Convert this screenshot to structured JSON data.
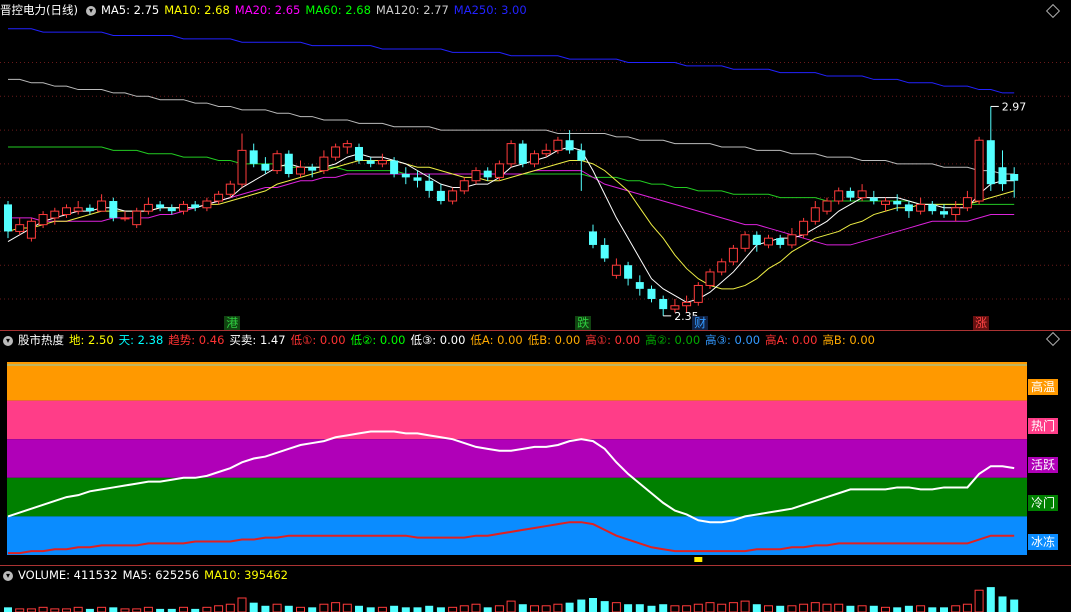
{
  "main_header": {
    "title": "晋控电力",
    "period": "(日线)",
    "ma": [
      {
        "label": "MA5:",
        "value": "2.75",
        "color": "#ffffff"
      },
      {
        "label": "MA10:",
        "value": "2.68",
        "color": "#ffff00"
      },
      {
        "label": "MA20:",
        "value": "2.65",
        "color": "#ff00ff"
      },
      {
        "label": "MA60:",
        "value": "2.68",
        "color": "#00ff00"
      },
      {
        "label": "MA120:",
        "value": "2.77",
        "color": "#cccccc"
      },
      {
        "label": "MA250:",
        "value": "3.00",
        "color": "#2222ff"
      }
    ]
  },
  "price_labels": {
    "high": "2.97",
    "low": "2.35"
  },
  "signals": [
    {
      "text": "港",
      "color": "#2ecc40",
      "bg": "#114411"
    },
    {
      "text": "跌",
      "color": "#2ecc40",
      "bg": "#114411"
    },
    {
      "text": "财",
      "color": "#3399ff",
      "bg": "#112244"
    },
    {
      "text": "涨",
      "color": "#ff4444",
      "bg": "#661111"
    }
  ],
  "heat_header": {
    "name": "股市热度",
    "items": [
      {
        "label": "地:",
        "value": "2.50",
        "color": "#ffff00"
      },
      {
        "label": "天:",
        "value": "2.38",
        "color": "#00ffff"
      },
      {
        "label": "趋势:",
        "value": "0.46",
        "color": "#ff3333"
      },
      {
        "label": "买卖:",
        "value": "1.47",
        "color": "#ffffff"
      },
      {
        "label": "低①:",
        "value": "0.00",
        "color": "#ff3333"
      },
      {
        "label": "低②:",
        "value": "0.00",
        "color": "#00ff00"
      },
      {
        "label": "低③:",
        "value": "0.00",
        "color": "#ffffff"
      },
      {
        "label": "低A:",
        "value": "0.00",
        "color": "#ffaa00"
      },
      {
        "label": "低B:",
        "value": "0.00",
        "color": "#ffaa00"
      },
      {
        "label": "高①:",
        "value": "0.00",
        "color": "#ff3333"
      },
      {
        "label": "高②:",
        "value": "0.00",
        "color": "#00aa00"
      },
      {
        "label": "高③:",
        "value": "0.00",
        "color": "#3399ff"
      },
      {
        "label": "高A:",
        "value": "0.00",
        "color": "#ff3333"
      },
      {
        "label": "高B:",
        "value": "0.00",
        "color": "#ffaa00"
      }
    ]
  },
  "zones": [
    {
      "label": "高温",
      "color": "#ff9900"
    },
    {
      "label": "热门",
      "color": "#ff3d88"
    },
    {
      "label": "活跃",
      "color": "#b000b8"
    },
    {
      "label": "冷门",
      "color": "#008000"
    },
    {
      "label": "冰冻",
      "color": "#0a8cff"
    }
  ],
  "vol_header": {
    "items": [
      {
        "label": "VOLUME:",
        "value": "411532",
        "color": "#ffffff"
      },
      {
        "label": "MA5:",
        "value": "625256",
        "color": "#ffffff"
      },
      {
        "label": "MA10:",
        "value": "395462",
        "color": "#ffff00"
      }
    ]
  },
  "chart_data": {
    "type": "candlestick",
    "candles": [
      [
        2.68,
        2.6,
        2.69,
        2.58
      ],
      [
        2.6,
        2.62,
        2.64,
        2.59
      ],
      [
        2.58,
        2.63,
        2.64,
        2.57
      ],
      [
        2.62,
        2.65,
        2.66,
        2.61
      ],
      [
        2.64,
        2.66,
        2.67,
        2.62
      ],
      [
        2.65,
        2.67,
        2.68,
        2.64
      ],
      [
        2.66,
        2.67,
        2.69,
        2.65
      ],
      [
        2.67,
        2.66,
        2.68,
        2.65
      ],
      [
        2.66,
        2.69,
        2.71,
        2.66
      ],
      [
        2.69,
        2.64,
        2.7,
        2.63
      ],
      [
        2.64,
        2.64,
        2.66,
        2.63
      ],
      [
        2.62,
        2.66,
        2.67,
        2.61
      ],
      [
        2.66,
        2.68,
        2.7,
        2.65
      ],
      [
        2.68,
        2.67,
        2.69,
        2.66
      ],
      [
        2.67,
        2.66,
        2.68,
        2.65
      ],
      [
        2.66,
        2.68,
        2.69,
        2.65
      ],
      [
        2.68,
        2.67,
        2.69,
        2.66
      ],
      [
        2.67,
        2.69,
        2.7,
        2.66
      ],
      [
        2.69,
        2.71,
        2.72,
        2.68
      ],
      [
        2.71,
        2.74,
        2.75,
        2.7
      ],
      [
        2.74,
        2.84,
        2.89,
        2.73
      ],
      [
        2.84,
        2.8,
        2.86,
        2.79
      ],
      [
        2.8,
        2.78,
        2.82,
        2.77
      ],
      [
        2.78,
        2.83,
        2.84,
        2.77
      ],
      [
        2.83,
        2.77,
        2.84,
        2.76
      ],
      [
        2.77,
        2.79,
        2.81,
        2.76
      ],
      [
        2.79,
        2.78,
        2.8,
        2.76
      ],
      [
        2.78,
        2.82,
        2.84,
        2.77
      ],
      [
        2.82,
        2.85,
        2.86,
        2.81
      ],
      [
        2.85,
        2.86,
        2.87,
        2.83
      ],
      [
        2.85,
        2.81,
        2.86,
        2.8
      ],
      [
        2.81,
        2.8,
        2.82,
        2.79
      ],
      [
        2.8,
        2.81,
        2.83,
        2.79
      ],
      [
        2.81,
        2.77,
        2.82,
        2.76
      ],
      [
        2.77,
        2.76,
        2.79,
        2.74
      ],
      [
        2.76,
        2.75,
        2.78,
        2.73
      ],
      [
        2.75,
        2.72,
        2.77,
        2.7
      ],
      [
        2.72,
        2.69,
        2.74,
        2.68
      ],
      [
        2.69,
        2.72,
        2.73,
        2.68
      ],
      [
        2.72,
        2.75,
        2.76,
        2.71
      ],
      [
        2.75,
        2.78,
        2.79,
        2.74
      ],
      [
        2.78,
        2.76,
        2.79,
        2.75
      ],
      [
        2.76,
        2.8,
        2.81,
        2.75
      ],
      [
        2.8,
        2.86,
        2.87,
        2.79
      ],
      [
        2.86,
        2.8,
        2.87,
        2.79
      ],
      [
        2.8,
        2.83,
        2.84,
        2.79
      ],
      [
        2.83,
        2.84,
        2.86,
        2.82
      ],
      [
        2.84,
        2.87,
        2.88,
        2.83
      ],
      [
        2.87,
        2.84,
        2.9,
        2.83
      ],
      [
        2.84,
        2.81,
        2.86,
        2.72
      ],
      [
        2.6,
        2.56,
        2.62,
        2.55
      ],
      [
        2.56,
        2.52,
        2.58,
        2.51
      ],
      [
        2.47,
        2.5,
        2.52,
        2.46
      ],
      [
        2.5,
        2.46,
        2.51,
        2.44
      ],
      [
        2.45,
        2.43,
        2.47,
        2.41
      ],
      [
        2.43,
        2.4,
        2.44,
        2.39
      ],
      [
        2.4,
        2.37,
        2.41,
        2.35
      ],
      [
        2.37,
        2.38,
        2.4,
        2.36
      ],
      [
        2.38,
        2.39,
        2.41,
        2.36
      ],
      [
        2.39,
        2.44,
        2.45,
        2.38
      ],
      [
        2.44,
        2.48,
        2.49,
        2.43
      ],
      [
        2.48,
        2.51,
        2.52,
        2.47
      ],
      [
        2.51,
        2.55,
        2.56,
        2.5
      ],
      [
        2.55,
        2.59,
        2.6,
        2.54
      ],
      [
        2.59,
        2.56,
        2.6,
        2.54
      ],
      [
        2.56,
        2.58,
        2.59,
        2.55
      ],
      [
        2.58,
        2.56,
        2.59,
        2.55
      ],
      [
        2.56,
        2.59,
        2.61,
        2.55
      ],
      [
        2.59,
        2.63,
        2.64,
        2.58
      ],
      [
        2.63,
        2.67,
        2.69,
        2.62
      ],
      [
        2.66,
        2.69,
        2.7,
        2.65
      ],
      [
        2.69,
        2.72,
        2.73,
        2.68
      ],
      [
        2.72,
        2.7,
        2.73,
        2.69
      ],
      [
        2.7,
        2.72,
        2.74,
        2.69
      ],
      [
        2.7,
        2.69,
        2.72,
        2.68
      ],
      [
        2.68,
        2.69,
        2.7,
        2.66
      ],
      [
        2.69,
        2.68,
        2.71,
        2.66
      ],
      [
        2.68,
        2.66,
        2.69,
        2.64
      ],
      [
        2.66,
        2.68,
        2.7,
        2.65
      ],
      [
        2.68,
        2.66,
        2.69,
        2.65
      ],
      [
        2.66,
        2.65,
        2.68,
        2.64
      ],
      [
        2.65,
        2.67,
        2.69,
        2.63
      ],
      [
        2.67,
        2.7,
        2.72,
        2.66
      ],
      [
        2.69,
        2.87,
        2.88,
        2.68
      ],
      [
        2.87,
        2.74,
        2.97,
        2.72
      ],
      [
        2.79,
        2.74,
        2.84,
        2.72
      ],
      [
        2.77,
        2.75,
        2.79,
        2.7
      ]
    ],
    "ma_lines": {
      "MA5": [
        2.57,
        2.59,
        2.61,
        2.63,
        2.64,
        2.65,
        2.66,
        2.66,
        2.67,
        2.67,
        2.66,
        2.66,
        2.66,
        2.67,
        2.67,
        2.67,
        2.67,
        2.68,
        2.69,
        2.7,
        2.73,
        2.75,
        2.77,
        2.79,
        2.8,
        2.79,
        2.79,
        2.79,
        2.8,
        2.82,
        2.83,
        2.82,
        2.82,
        2.81,
        2.8,
        2.78,
        2.76,
        2.74,
        2.73,
        2.73,
        2.74,
        2.74,
        2.76,
        2.79,
        2.8,
        2.81,
        2.82,
        2.84,
        2.85,
        2.84,
        2.78,
        2.71,
        2.64,
        2.58,
        2.52,
        2.46,
        2.43,
        2.41,
        2.39,
        2.4,
        2.42,
        2.45,
        2.48,
        2.52,
        2.56,
        2.57,
        2.58,
        2.58,
        2.59,
        2.61,
        2.63,
        2.66,
        2.68,
        2.7,
        2.7,
        2.7,
        2.7,
        2.69,
        2.68,
        2.68,
        2.67,
        2.67,
        2.67,
        2.71,
        2.74,
        2.75,
        2.75
      ],
      "MA10": [
        2.6,
        2.61,
        2.61,
        2.62,
        2.63,
        2.63,
        2.64,
        2.65,
        2.66,
        2.66,
        2.66,
        2.66,
        2.66,
        2.67,
        2.67,
        2.67,
        2.67,
        2.68,
        2.68,
        2.69,
        2.7,
        2.71,
        2.72,
        2.74,
        2.75,
        2.76,
        2.77,
        2.78,
        2.79,
        2.8,
        2.81,
        2.81,
        2.81,
        2.81,
        2.8,
        2.79,
        2.79,
        2.78,
        2.77,
        2.76,
        2.76,
        2.75,
        2.75,
        2.76,
        2.77,
        2.78,
        2.79,
        2.8,
        2.81,
        2.81,
        2.8,
        2.78,
        2.75,
        2.72,
        2.67,
        2.62,
        2.58,
        2.53,
        2.49,
        2.46,
        2.44,
        2.43,
        2.43,
        2.44,
        2.46,
        2.49,
        2.51,
        2.54,
        2.56,
        2.58,
        2.59,
        2.6,
        2.62,
        2.63,
        2.65,
        2.66,
        2.67,
        2.67,
        2.68,
        2.68,
        2.68,
        2.68,
        2.68,
        2.69,
        2.7,
        2.71,
        2.72
      ],
      "MA20": [
        2.64,
        2.64,
        2.64,
        2.63,
        2.63,
        2.63,
        2.63,
        2.63,
        2.63,
        2.64,
        2.64,
        2.64,
        2.64,
        2.65,
        2.65,
        2.66,
        2.67,
        2.68,
        2.69,
        2.7,
        2.71,
        2.72,
        2.73,
        2.73,
        2.74,
        2.75,
        2.75,
        2.76,
        2.76,
        2.77,
        2.77,
        2.77,
        2.77,
        2.77,
        2.77,
        2.77,
        2.77,
        2.77,
        2.77,
        2.77,
        2.77,
        2.77,
        2.77,
        2.77,
        2.77,
        2.78,
        2.78,
        2.78,
        2.78,
        2.78,
        2.76,
        2.74,
        2.73,
        2.72,
        2.71,
        2.7,
        2.69,
        2.68,
        2.67,
        2.66,
        2.65,
        2.64,
        2.63,
        2.62,
        2.62,
        2.61,
        2.6,
        2.59,
        2.58,
        2.57,
        2.56,
        2.56,
        2.56,
        2.57,
        2.58,
        2.59,
        2.6,
        2.61,
        2.62,
        2.63,
        2.63,
        2.63,
        2.63,
        2.64,
        2.65,
        2.65,
        2.65
      ],
      "MA60": [
        2.85,
        2.85,
        2.85,
        2.85,
        2.85,
        2.85,
        2.85,
        2.85,
        2.85,
        2.84,
        2.84,
        2.84,
        2.83,
        2.83,
        2.83,
        2.82,
        2.82,
        2.82,
        2.81,
        2.81,
        2.8,
        2.8,
        2.8,
        2.8,
        2.79,
        2.79,
        2.79,
        2.79,
        2.79,
        2.78,
        2.78,
        2.78,
        2.78,
        2.78,
        2.77,
        2.77,
        2.77,
        2.77,
        2.77,
        2.77,
        2.77,
        2.77,
        2.77,
        2.77,
        2.77,
        2.77,
        2.77,
        2.77,
        2.77,
        2.77,
        2.76,
        2.76,
        2.76,
        2.75,
        2.75,
        2.74,
        2.74,
        2.73,
        2.73,
        2.72,
        2.72,
        2.72,
        2.71,
        2.71,
        2.71,
        2.71,
        2.7,
        2.7,
        2.7,
        2.7,
        2.69,
        2.69,
        2.69,
        2.69,
        2.69,
        2.69,
        2.69,
        2.69,
        2.68,
        2.68,
        2.68,
        2.68,
        2.68,
        2.68,
        2.68,
        2.68,
        2.68
      ],
      "MA120": [
        3.05,
        3.05,
        3.04,
        3.04,
        3.03,
        3.03,
        3.02,
        3.02,
        3.02,
        3.01,
        3.01,
        3.0,
        3.0,
        2.99,
        2.99,
        2.99,
        2.98,
        2.98,
        2.97,
        2.97,
        2.96,
        2.96,
        2.96,
        2.95,
        2.95,
        2.94,
        2.94,
        2.93,
        2.93,
        2.93,
        2.92,
        2.92,
        2.92,
        2.91,
        2.91,
        2.91,
        2.91,
        2.9,
        2.9,
        2.9,
        2.9,
        2.9,
        2.9,
        2.9,
        2.9,
        2.9,
        2.9,
        2.89,
        2.89,
        2.89,
        2.89,
        2.89,
        2.88,
        2.88,
        2.87,
        2.87,
        2.87,
        2.86,
        2.86,
        2.86,
        2.86,
        2.85,
        2.85,
        2.85,
        2.84,
        2.84,
        2.84,
        2.83,
        2.83,
        2.83,
        2.82,
        2.82,
        2.82,
        2.81,
        2.81,
        2.81,
        2.8,
        2.8,
        2.8,
        2.8,
        2.79,
        2.79,
        2.79,
        2.78,
        2.78,
        2.77,
        2.77
      ],
      "MA250": [
        3.2,
        3.2,
        3.2,
        3.19,
        3.19,
        3.19,
        3.19,
        3.19,
        3.19,
        3.18,
        3.18,
        3.18,
        3.18,
        3.18,
        3.18,
        3.17,
        3.17,
        3.17,
        3.17,
        3.17,
        3.16,
        3.16,
        3.16,
        3.16,
        3.16,
        3.16,
        3.15,
        3.15,
        3.15,
        3.15,
        3.15,
        3.15,
        3.14,
        3.14,
        3.14,
        3.14,
        3.14,
        3.14,
        3.13,
        3.13,
        3.13,
        3.13,
        3.13,
        3.12,
        3.12,
        3.12,
        3.12,
        3.12,
        3.11,
        3.11,
        3.11,
        3.11,
        3.11,
        3.1,
        3.1,
        3.1,
        3.1,
        3.1,
        3.09,
        3.09,
        3.09,
        3.09,
        3.08,
        3.08,
        3.08,
        3.08,
        3.07,
        3.07,
        3.07,
        3.07,
        3.06,
        3.06,
        3.06,
        3.06,
        3.05,
        3.05,
        3.05,
        3.04,
        3.04,
        3.04,
        3.03,
        3.03,
        3.03,
        3.02,
        3.02,
        3.01,
        3.01
      ]
    },
    "price_range": [
      2.32,
      3.22
    ],
    "heat_line": [
      20,
      22,
      24,
      26,
      28,
      30,
      31,
      33,
      34,
      35,
      36,
      37,
      38,
      38,
      39,
      40,
      40,
      41,
      43,
      45,
      48,
      50,
      51,
      53,
      55,
      57,
      58,
      59,
      61,
      62,
      63,
      64,
      64,
      64,
      63,
      63,
      62,
      61,
      60,
      58,
      56,
      55,
      54,
      54,
      55,
      56,
      56,
      57,
      59,
      60,
      59,
      55,
      48,
      42,
      37,
      32,
      27,
      23,
      21,
      18,
      17,
      17,
      18,
      20,
      21,
      22,
      23,
      24,
      26,
      28,
      30,
      32,
      34,
      34,
      34,
      34,
      35,
      35,
      34,
      34,
      35,
      35,
      35,
      42,
      46,
      46,
      45
    ],
    "trend_line": [
      1,
      1,
      2,
      2,
      3,
      3,
      4,
      4,
      5,
      5,
      5,
      5,
      6,
      6,
      6,
      6,
      7,
      7,
      7,
      7,
      8,
      8,
      9,
      9,
      10,
      10,
      10,
      10,
      10,
      10,
      10,
      10,
      10,
      10,
      10,
      9,
      9,
      9,
      9,
      9,
      10,
      10,
      11,
      12,
      13,
      14,
      15,
      16,
      17,
      17,
      16,
      13,
      10,
      8,
      6,
      4,
      3,
      2,
      2,
      2,
      2,
      2,
      2,
      2,
      3,
      3,
      3,
      4,
      4,
      5,
      5,
      6,
      6,
      6,
      6,
      6,
      6,
      6,
      6,
      6,
      6,
      6,
      6,
      8,
      10,
      10,
      10
    ],
    "heat_range": [
      0,
      100
    ],
    "volume": [
      3,
      2,
      2,
      3,
      2,
      2,
      3,
      2,
      3,
      3,
      2,
      2,
      3,
      2,
      2,
      3,
      2,
      3,
      4,
      5,
      9,
      6,
      4,
      5,
      4,
      3,
      3,
      5,
      6,
      5,
      4,
      3,
      3,
      4,
      3,
      3,
      4,
      3,
      3,
      4,
      5,
      3,
      4,
      7,
      5,
      4,
      4,
      5,
      6,
      8,
      9,
      7,
      6,
      5,
      5,
      4,
      5,
      4,
      4,
      5,
      6,
      5,
      6,
      7,
      5,
      4,
      4,
      4,
      5,
      6,
      5,
      5,
      4,
      4,
      4,
      3,
      3,
      4,
      4,
      3,
      3,
      4,
      5,
      14,
      16,
      10,
      8
    ],
    "volume_max": 18
  }
}
